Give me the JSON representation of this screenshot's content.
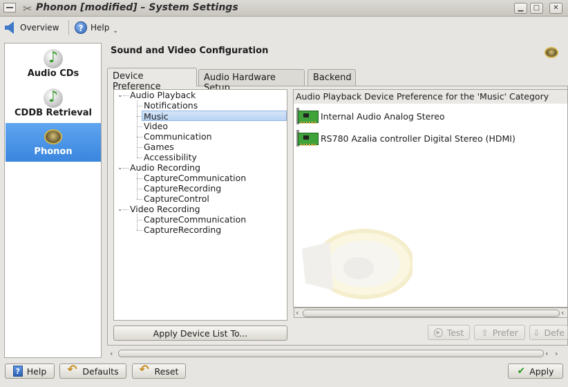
{
  "window": {
    "title": "Phonon [modified] – System Settings",
    "app_icon": "tools-icon",
    "buttons": [
      "minimize",
      "maximize",
      "close"
    ]
  },
  "toolbar": {
    "overview_label": "Overview",
    "help_label": "Help"
  },
  "sidebar": {
    "items": [
      {
        "label": "Audio CDs",
        "icon": "music-note-disc-icon",
        "selected": false
      },
      {
        "label": "CDDB Retrieval",
        "icon": "music-note-disc-icon",
        "selected": false
      },
      {
        "label": "Phonon",
        "icon": "speaker-icon",
        "selected": true
      }
    ]
  },
  "page": {
    "title": "Sound and Video Configuration",
    "tabs": [
      {
        "label": "Device Preference",
        "active": true
      },
      {
        "label": "Audio Hardware Setup",
        "active": false
      },
      {
        "label": "Backend",
        "active": false
      }
    ]
  },
  "tree": {
    "groups": [
      {
        "label": "Audio Playback",
        "children": [
          "Notifications",
          "Music",
          "Video",
          "Communication",
          "Games",
          "Accessibility"
        ]
      },
      {
        "label": "Audio Recording",
        "children": [
          "CaptureCommunication",
          "CaptureRecording",
          "CaptureControl"
        ]
      },
      {
        "label": "Video Recording",
        "children": [
          "CaptureCommunication",
          "CaptureRecording"
        ]
      }
    ],
    "selected": "Music"
  },
  "device_list": {
    "header": "Audio Playback Device Preference for the 'Music' Category",
    "devices": [
      "Internal Audio Analog Stereo",
      "RS780 Azalia controller Digital Stereo (HDMI)"
    ]
  },
  "actions": {
    "apply_device_list": "Apply Device List To...",
    "test": "Test",
    "prefer": "Prefer",
    "defer": "Defe"
  },
  "footer": {
    "help": "Help",
    "defaults": "Defaults",
    "reset": "Reset",
    "apply": "Apply"
  },
  "colors": {
    "selection": "#3a86de",
    "tree_selection": "#b8d3f3",
    "accent_green": "#2f9a28"
  }
}
